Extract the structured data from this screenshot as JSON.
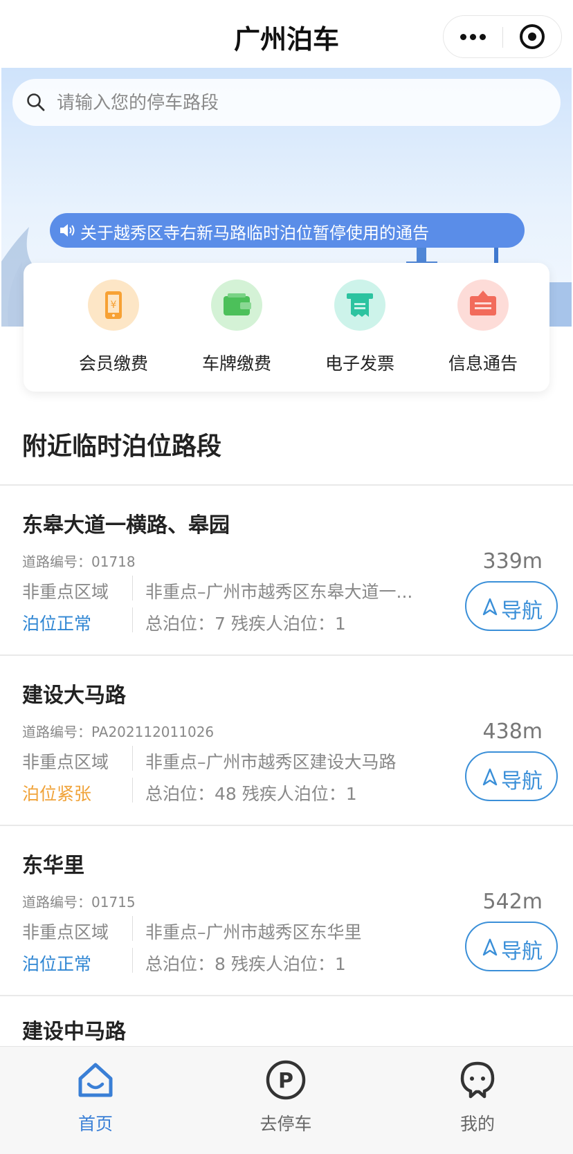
{
  "header": {
    "title": "广州泊车"
  },
  "search": {
    "placeholder": "请输入您的停车路段"
  },
  "notice": {
    "text": "关于越秀区寺右新马路临时泊位暂停使用的通告"
  },
  "quick_actions": [
    {
      "label": "会员缴费",
      "icon": "phone-yuan-icon",
      "color": "#f7a134"
    },
    {
      "label": "车牌缴费",
      "icon": "wallet-icon",
      "color": "#4cc05a"
    },
    {
      "label": "电子发票",
      "icon": "receipt-icon",
      "color": "#2cc3a0"
    },
    {
      "label": "信息通告",
      "icon": "notice-board-icon",
      "color": "#f26b5b"
    }
  ],
  "section": {
    "title": "附近临时泊位路段"
  },
  "labels": {
    "code_prefix": "道路编号：",
    "nav": "导航"
  },
  "lots": [
    {
      "name": "东皋大道一横路、皋园",
      "code": "道路编号：01718",
      "area": "非重点区域",
      "status": "泊位正常",
      "status_color": "#2f86d3",
      "address": "非重点–广州市越秀区东皋大道一...",
      "spots": "总泊位：7  残疾人泊位：1",
      "distance": "339m"
    },
    {
      "name": "建设大马路",
      "code": "道路编号：PA202112011026",
      "area": "非重点区域",
      "status": "泊位紧张",
      "status_color": "#f0a33a",
      "address": "非重点–广州市越秀区建设大马路",
      "spots": "总泊位：48  残疾人泊位：1",
      "distance": "438m"
    },
    {
      "name": "东华里",
      "code": "道路编号：01715",
      "area": "非重点区域",
      "status": "泊位正常",
      "status_color": "#2f86d3",
      "address": "非重点–广州市越秀区东华里",
      "spots": "总泊位：8  残疾人泊位：1",
      "distance": "542m"
    },
    {
      "name": "建设中马路"
    }
  ],
  "tabs": [
    {
      "label": "首页",
      "icon": "home-icon",
      "active": true
    },
    {
      "label": "去停车",
      "icon": "parking-icon",
      "active": false
    },
    {
      "label": "我的",
      "icon": "profile-icon",
      "active": false
    }
  ],
  "colors": {
    "accent": "#3a7fd6",
    "notice_bg": "#5a8de8",
    "status_normal": "#2f86d3",
    "status_busy": "#f0a33a"
  }
}
